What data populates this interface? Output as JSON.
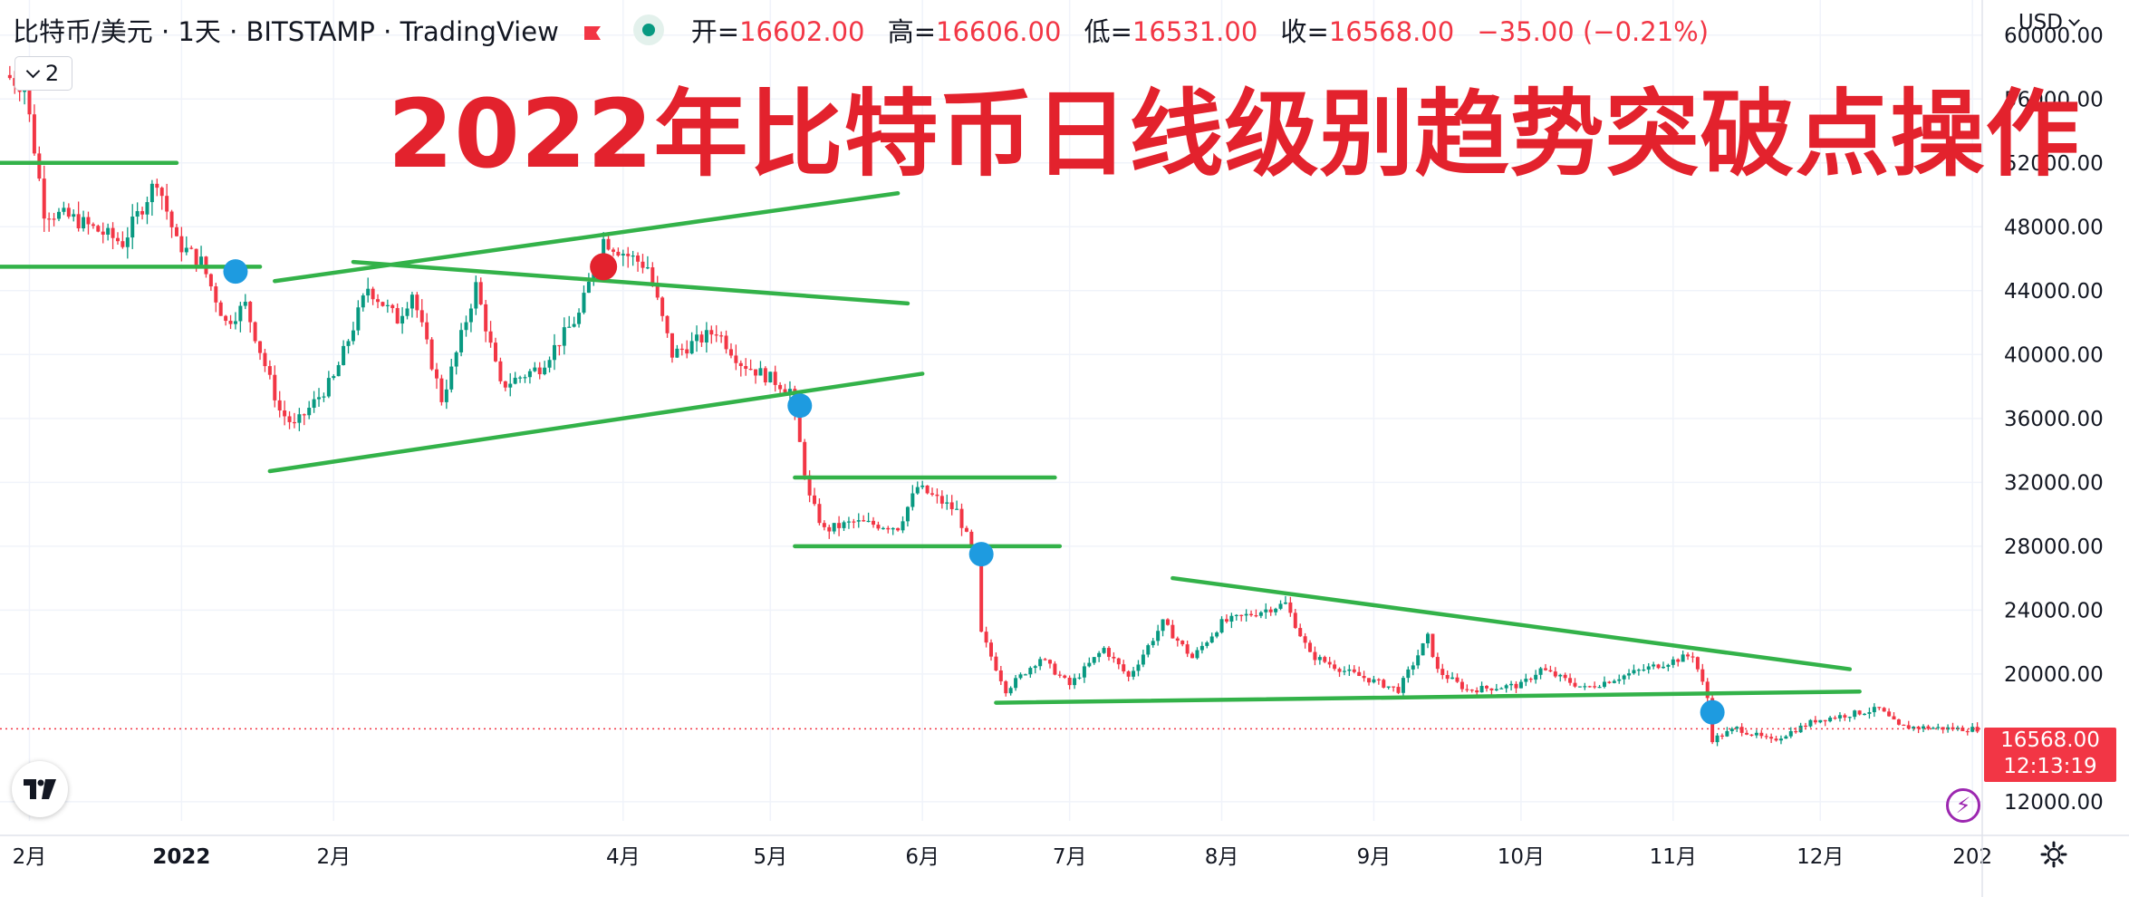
{
  "header": {
    "symbol": "比特币/美元 · 1天 · BITSTAMP · TradingView",
    "open_label": "开=",
    "open": "16602.00",
    "high_label": "高=",
    "high": "16606.00",
    "low_label": "低=",
    "low": "16531.00",
    "close_label": "收=",
    "close": "16568.00",
    "change": "−35.00 (−0.21%)",
    "collapse_count": "2",
    "currency": "USD"
  },
  "title": "2022年比特币日线级别趋势突破点操作",
  "current_price": {
    "label": "16568.00",
    "countdown": "12:13:19"
  },
  "logo": "TV",
  "colors": {
    "up": "#089981",
    "down": "#f23645",
    "trendline": "#33b249",
    "marker_blue": "#1e9be0",
    "marker_red": "#e3222d",
    "title": "#e3222d",
    "grid": "#f0f3fa"
  },
  "icons": [
    "flag-icon",
    "status-dot-icon",
    "chevron-down-icon",
    "tradingview-logo-icon",
    "lightning-icon",
    "gear-icon"
  ],
  "chart_data": {
    "type": "candlestick",
    "title": "2022年比特币日线级别趋势突破点操作",
    "x_range": [
      "2021-11-25",
      "2023-01-03"
    ],
    "ylim": [
      10800,
      62200
    ],
    "y_ticks": [
      60000,
      56000,
      52000,
      48000,
      44000,
      40000,
      36000,
      32000,
      28000,
      24000,
      20000,
      12000
    ],
    "y_tick_labels": [
      "60000.00",
      "56000.00",
      "52000.00",
      "48000.00",
      "44000.00",
      "40000.00",
      "36000.00",
      "32000.00",
      "28000.00",
      "24000.00",
      "20000.00",
      "12000.00"
    ],
    "x_ticks": [
      {
        "date": "2021-12-01",
        "label": "2月"
      },
      {
        "date": "2022-01-01",
        "label": "2022"
      },
      {
        "date": "2022-02-01",
        "label": "2月"
      },
      {
        "date": "2022-04-01",
        "label": "4月"
      },
      {
        "date": "2022-05-01",
        "label": "5月"
      },
      {
        "date": "2022-06-01",
        "label": "6月"
      },
      {
        "date": "2022-07-01",
        "label": "7月"
      },
      {
        "date": "2022-08-01",
        "label": "8月"
      },
      {
        "date": "2022-09-01",
        "label": "9月"
      },
      {
        "date": "2022-10-01",
        "label": "10月"
      },
      {
        "date": "2022-11-01",
        "label": "11月"
      },
      {
        "date": "2022-12-01",
        "label": "12月"
      },
      {
        "date": "2023-01-01",
        "label": "202"
      }
    ],
    "price_path": [
      [
        "2021-11-26",
        57500
      ],
      [
        "2021-11-30",
        56800
      ],
      [
        "2021-12-04",
        49000
      ],
      [
        "2021-12-10",
        48500
      ],
      [
        "2021-12-20",
        47000
      ],
      [
        "2021-12-27",
        51000
      ],
      [
        "2021-12-31",
        47000
      ],
      [
        "2022-01-05",
        45800
      ],
      [
        "2022-01-10",
        42000
      ],
      [
        "2022-01-14",
        43100
      ],
      [
        "2022-01-21",
        36500
      ],
      [
        "2022-01-24",
        35500
      ],
      [
        "2022-02-01",
        38500
      ],
      [
        "2022-02-08",
        44200
      ],
      [
        "2022-02-14",
        42200
      ],
      [
        "2022-02-17",
        43900
      ],
      [
        "2022-02-23",
        37200
      ],
      [
        "2022-02-25",
        39000
      ],
      [
        "2022-03-02",
        44300
      ],
      [
        "2022-03-07",
        38000
      ],
      [
        "2022-03-15",
        39200
      ],
      [
        "2022-03-23",
        42500
      ],
      [
        "2022-03-28",
        47200
      ],
      [
        "2022-04-02",
        46200
      ],
      [
        "2022-04-06",
        45500
      ],
      [
        "2022-04-11",
        40000
      ],
      [
        "2022-04-20",
        41500
      ],
      [
        "2022-04-25",
        39500
      ],
      [
        "2022-05-01",
        38500
      ],
      [
        "2022-05-05",
        37800
      ],
      [
        "2022-05-09",
        31000
      ],
      [
        "2022-05-12",
        29000
      ],
      [
        "2022-05-18",
        29500
      ],
      [
        "2022-05-27",
        29200
      ],
      [
        "2022-05-31",
        31700
      ],
      [
        "2022-06-08",
        30200
      ],
      [
        "2022-06-12",
        27000
      ],
      [
        "2022-06-13",
        22500
      ],
      [
        "2022-06-18",
        19000
      ],
      [
        "2022-06-25",
        21000
      ],
      [
        "2022-07-01",
        19300
      ],
      [
        "2022-07-08",
        21600
      ],
      [
        "2022-07-13",
        19800
      ],
      [
        "2022-07-20",
        23200
      ],
      [
        "2022-07-26",
        21000
      ],
      [
        "2022-08-01",
        23200
      ],
      [
        "2022-08-14",
        24400
      ],
      [
        "2022-08-19",
        21200
      ],
      [
        "2022-08-26",
        20200
      ],
      [
        "2022-09-06",
        19000
      ],
      [
        "2022-09-12",
        22300
      ],
      [
        "2022-09-14",
        20200
      ],
      [
        "2022-09-20",
        19000
      ],
      [
        "2022-10-01",
        19300
      ],
      [
        "2022-10-05",
        20300
      ],
      [
        "2022-10-14",
        19100
      ],
      [
        "2022-10-25",
        20200
      ],
      [
        "2022-11-05",
        21200
      ],
      [
        "2022-11-08",
        18500
      ],
      [
        "2022-11-09",
        15900
      ],
      [
        "2022-11-14",
        16600
      ],
      [
        "2022-11-21",
        15800
      ],
      [
        "2022-11-30",
        17100
      ],
      [
        "2022-12-13",
        17800
      ],
      [
        "2022-12-17",
        16700
      ],
      [
        "2022-12-31",
        16550
      ],
      [
        "2023-01-02",
        16568
      ]
    ],
    "last_close": 16568,
    "trendlines": [
      {
        "from": [
          "2021-11-25",
          52000
        ],
        "to": [
          "2021-12-31",
          52000
        ]
      },
      {
        "from": [
          "2021-11-25",
          45500
        ],
        "to": [
          "2022-01-17",
          45500
        ]
      },
      {
        "from": [
          "2022-01-20",
          44600
        ],
        "to": [
          "2022-05-27",
          50100
        ]
      },
      {
        "from": [
          "2022-02-05",
          45800
        ],
        "to": [
          "2022-05-29",
          43200
        ]
      },
      {
        "from": [
          "2022-01-19",
          32700
        ],
        "to": [
          "2022-06-01",
          38800
        ]
      },
      {
        "from": [
          "2022-05-06",
          32300
        ],
        "to": [
          "2022-06-28",
          32300
        ]
      },
      {
        "from": [
          "2022-05-06",
          28000
        ],
        "to": [
          "2022-06-29",
          28000
        ]
      },
      {
        "from": [
          "2022-07-22",
          26000
        ],
        "to": [
          "2022-12-07",
          20300
        ]
      },
      {
        "from": [
          "2022-06-16",
          18200
        ],
        "to": [
          "2022-12-09",
          18900
        ]
      }
    ],
    "markers": [
      {
        "date": "2022-01-12",
        "price": 45200,
        "color": "blue"
      },
      {
        "date": "2022-03-28",
        "price": 45500,
        "color": "red"
      },
      {
        "date": "2022-05-07",
        "price": 36800,
        "color": "blue"
      },
      {
        "date": "2022-06-13",
        "price": 27500,
        "color": "blue"
      },
      {
        "date": "2022-11-09",
        "price": 17600,
        "color": "blue"
      }
    ]
  }
}
